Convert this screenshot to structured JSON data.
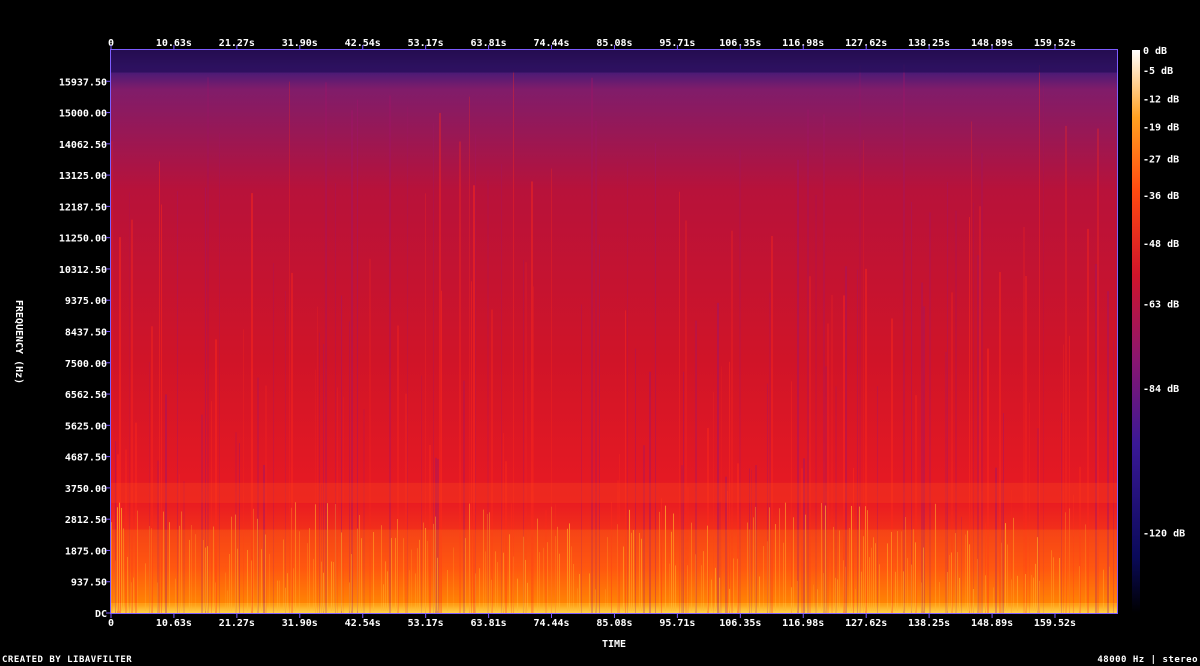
{
  "chart_data": {
    "type": "heatmap",
    "title": "",
    "xlabel": "TIME",
    "ylabel": "FREQUENCY (Hz)",
    "x_ticks": [
      "0",
      "10.63s",
      "21.27s",
      "31.90s",
      "42.54s",
      "53.17s",
      "63.81s",
      "74.44s",
      "85.08s",
      "95.71s",
      "106.35s",
      "116.98s",
      "127.62s",
      "138.25s",
      "148.89s",
      "159.52s"
    ],
    "x_tick_values": [
      0,
      10.63,
      21.27,
      31.9,
      42.54,
      53.17,
      63.81,
      74.44,
      85.08,
      95.71,
      106.35,
      116.98,
      127.62,
      138.25,
      148.89,
      159.52
    ],
    "xlim": [
      0,
      170
    ],
    "y_ticks": [
      "DC",
      "937.50",
      "1875.00",
      "2812.50",
      "3750.00",
      "4687.50",
      "5625.00",
      "6562.50",
      "7500.00",
      "8437.50",
      "9375.00",
      "10312.50",
      "11250.00",
      "12187.50",
      "13125.00",
      "14062.50",
      "15000.00",
      "15937.50"
    ],
    "y_tick_values": [
      0,
      937.5,
      1875,
      2812.5,
      3750,
      4687.5,
      5625,
      6562.5,
      7500,
      8437.5,
      9375,
      10312.5,
      11250,
      12187.5,
      13125,
      14062.5,
      15000,
      15937.5
    ],
    "ylim": [
      0,
      16875
    ],
    "colorbar": {
      "labels": [
        "0 dB",
        "-5 dB",
        "-12 dB",
        "-19 dB",
        "-27 dB",
        "-36 dB",
        "-48 dB",
        "-63 dB",
        "-84 dB",
        "-120 dB"
      ],
      "values": [
        0,
        -5,
        -12,
        -19,
        -27,
        -36,
        -48,
        -63,
        -84,
        -120
      ],
      "range": [
        -140,
        0
      ]
    },
    "colors": {
      "very_low": "#05001a",
      "low": "#4a1a8c",
      "mid": "#d8102a",
      "high": "#ff6a00",
      "peak": "#fff6c8",
      "axis": "#7d5cff"
    },
    "energy_bands": [
      {
        "from_hz": 0,
        "to_hz": 300,
        "level_db": -5
      },
      {
        "from_hz": 300,
        "to_hz": 2500,
        "level_db": -19
      },
      {
        "from_hz": 3300,
        "to_hz": 3900,
        "level_db": -22
      },
      {
        "from_hz": 4000,
        "to_hz": 16200,
        "level_db": -36
      },
      {
        "from_hz": 16200,
        "to_hz": 16875,
        "level_db": -84
      }
    ]
  },
  "footer": {
    "credit": "CREATED BY LIBAVFILTER",
    "info": "48000 Hz | stereo"
  }
}
